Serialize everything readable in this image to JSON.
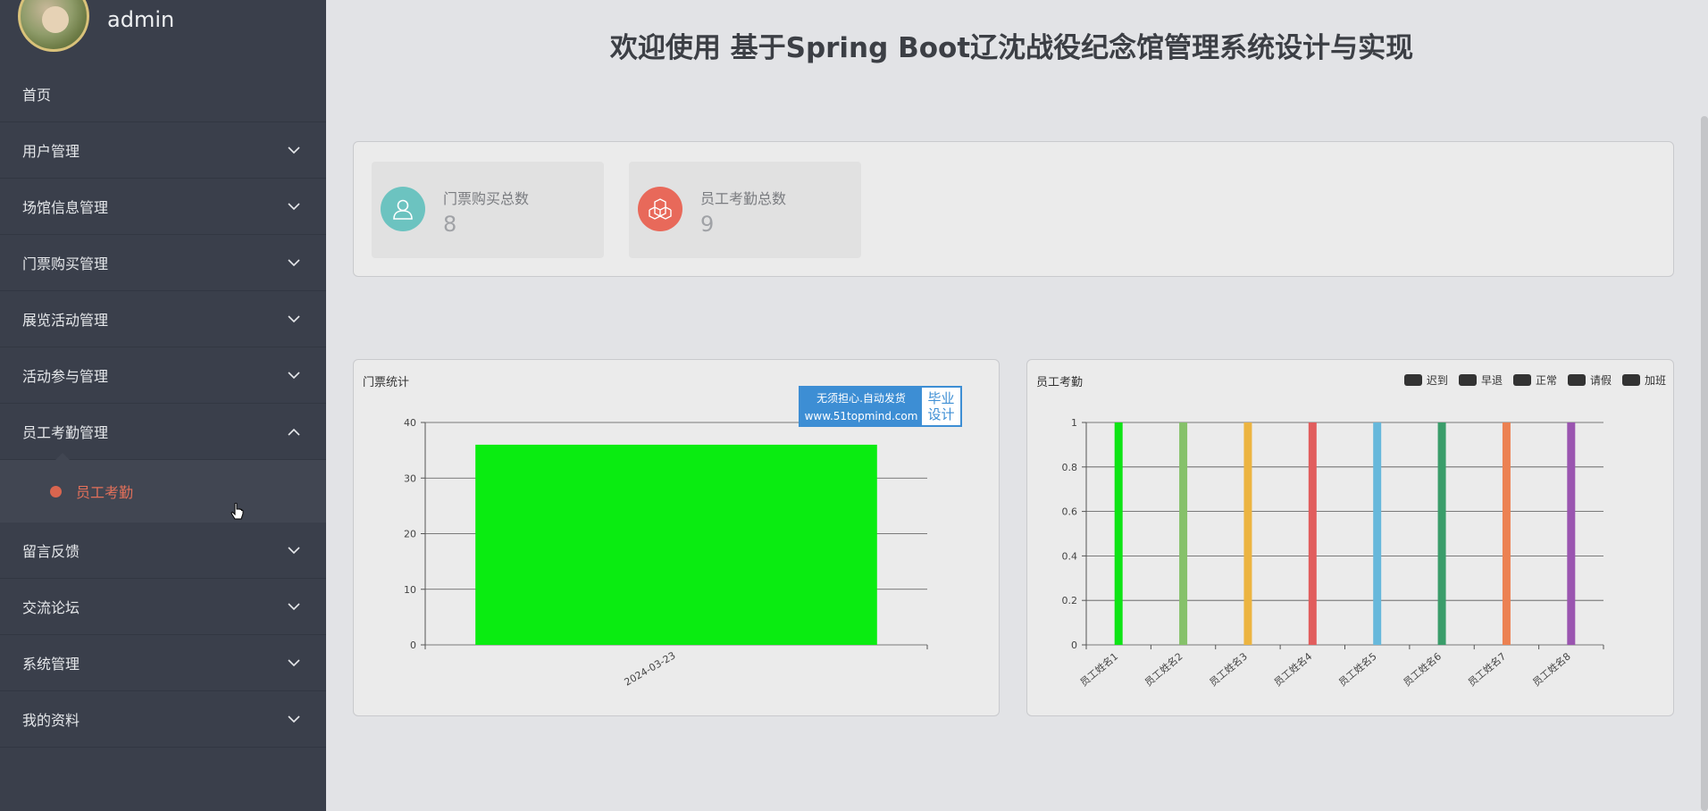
{
  "sidebar": {
    "user_name": "admin",
    "items": [
      {
        "label": "首页",
        "expandable": false
      },
      {
        "label": "用户管理",
        "expandable": true
      },
      {
        "label": "场馆信息管理",
        "expandable": true
      },
      {
        "label": "门票购买管理",
        "expandable": true
      },
      {
        "label": "展览活动管理",
        "expandable": true
      },
      {
        "label": "活动参与管理",
        "expandable": true
      },
      {
        "label": "员工考勤管理",
        "expandable": true,
        "expanded": true
      },
      {
        "label": "留言反馈",
        "expandable": true
      },
      {
        "label": "交流论坛",
        "expandable": true
      },
      {
        "label": "系统管理",
        "expandable": true
      },
      {
        "label": "我的资料",
        "expandable": true
      }
    ],
    "active_subitem": "员工考勤"
  },
  "main": {
    "title": "欢迎使用 基于Spring Boot辽沈战役纪念馆管理系统设计与实现",
    "stats": [
      {
        "label": "门票购买总数",
        "value": "8",
        "color": "#6cc3c0",
        "icon": "user-icon"
      },
      {
        "label": "员工考勤总数",
        "value": "9",
        "color": "#e8695a",
        "icon": "cubes-icon"
      }
    ]
  },
  "watermark": {
    "line1": "无须担心.自动发货",
    "line2": "www.51topmind.com",
    "right": "毕业设计"
  },
  "chart_data": [
    {
      "type": "bar",
      "title": "门票统计",
      "categories": [
        "2024-03-23"
      ],
      "values": [
        36
      ],
      "ylim": [
        0,
        40
      ],
      "yticks": [
        0,
        10,
        20,
        30,
        40
      ],
      "colors": [
        "#0aec11"
      ]
    },
    {
      "type": "bar",
      "title": "员工考勤",
      "categories": [
        "员工姓名1",
        "员工姓名2",
        "员工姓名3",
        "员工姓名4",
        "员工姓名5",
        "员工姓名6",
        "员工姓名7",
        "员工姓名8"
      ],
      "values": [
        1,
        1,
        1,
        1,
        1,
        1,
        1,
        1
      ],
      "ylim": [
        0,
        1
      ],
      "yticks": [
        "0",
        "0.2",
        "0.4",
        "0.6",
        "0.8",
        "1"
      ],
      "colors": [
        "#0ee415",
        "#86c16a",
        "#ecb441",
        "#e15d5d",
        "#67b8db",
        "#3a9d6a",
        "#ec8152",
        "#9a55b0"
      ],
      "legend": [
        "迟到",
        "早退",
        "正常",
        "请假",
        "加班"
      ],
      "legend_position": "top-right"
    }
  ]
}
